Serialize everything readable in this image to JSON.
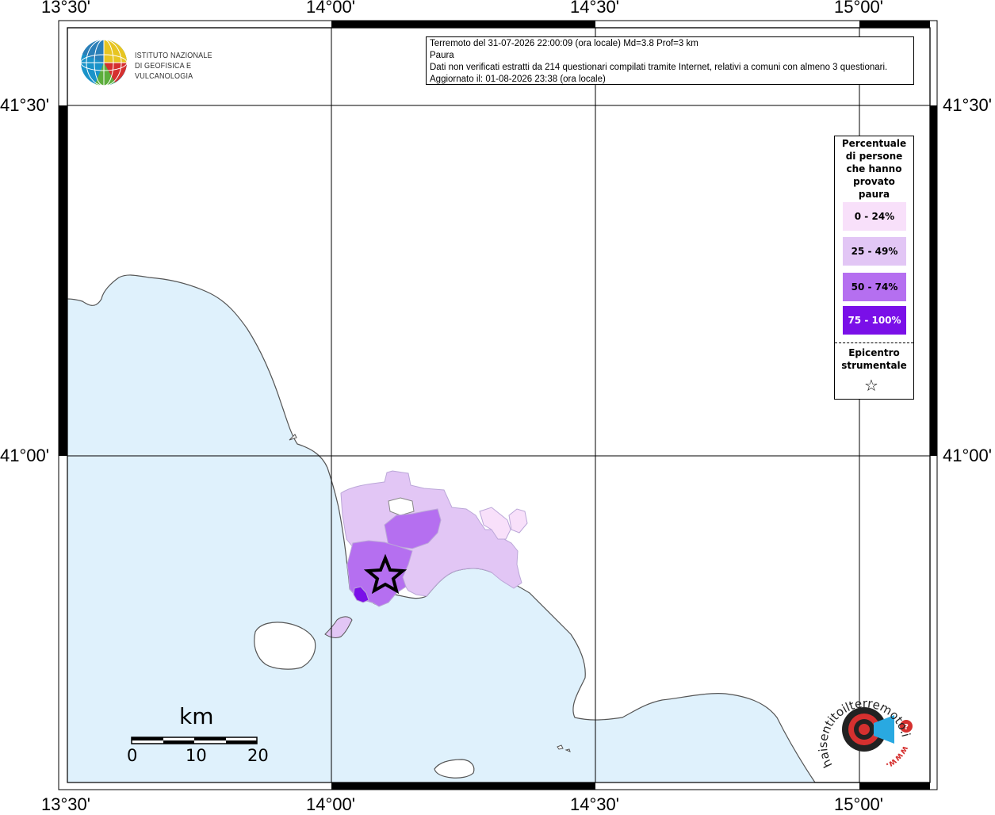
{
  "info": {
    "line1": "Terremoto del 31-07-2026 22:00:09 (ora locale) Md=3.8 Prof=3 km",
    "line2": "Paura",
    "line3": "Dati non verificati estratti da 214 questionari compilati tramite Internet, relativi a comuni con almeno 3 questionari.",
    "line4": "Aggiornato il: 01-08-2026 23:38 (ora locale)"
  },
  "logo_ingv": {
    "line1": "ISTITUTO NAZIONALE",
    "line2": "DI GEOFISICA E VULCANOLOGIA"
  },
  "coords": {
    "lon": [
      "13°30'",
      "14°00'",
      "14°30'",
      "15°00'"
    ],
    "lat": [
      "41°30'",
      "41°00'"
    ]
  },
  "legend": {
    "title": "Percentuale di persone che hanno provato paura",
    "classes": [
      {
        "label": "0 - 24%",
        "color": "#f8e0fa"
      },
      {
        "label": "25 - 49%",
        "color": "#e2c6f5"
      },
      {
        "label": "50 - 74%",
        "color": "#b56ff0"
      },
      {
        "label": "75 - 100%",
        "color": "#7a10e8"
      }
    ],
    "epicentre_label": "Epicentro strumentale",
    "epicentre_icon": "star-icon"
  },
  "scale": {
    "unit": "km",
    "ticks": [
      "0",
      "10",
      "20"
    ]
  },
  "logo_hsit": {
    "text": "haisentitoilterremoto.it",
    "prefix": "www."
  },
  "colors": {
    "sea": "#dff1fc",
    "land": "#ffffff",
    "coastline": "#555555",
    "grid": "#000000"
  }
}
